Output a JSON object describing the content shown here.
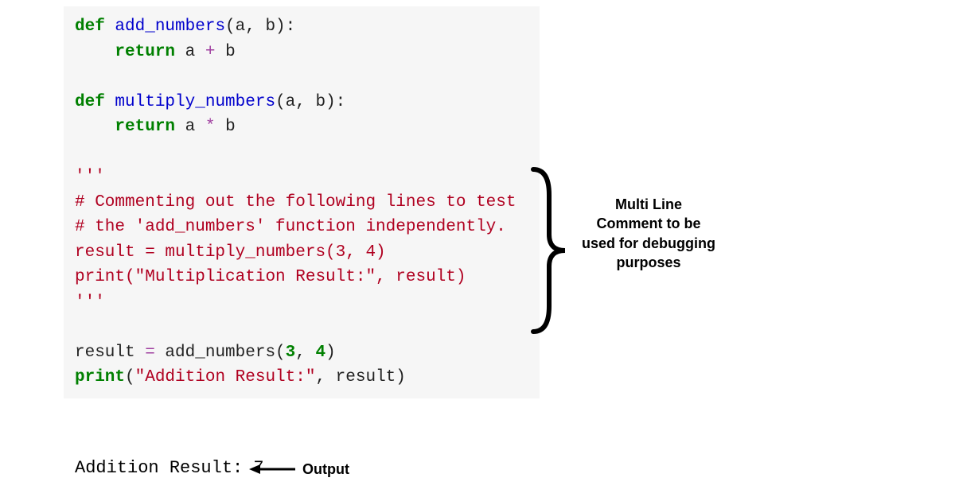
{
  "code": {
    "l1": {
      "def": "def",
      "sp1": " ",
      "name": "add_numbers",
      "sig": "(a, b):"
    },
    "l2": {
      "indent": "    ",
      "ret": "return",
      "sp": " a ",
      "op": "+",
      "b": " b"
    },
    "l3": "",
    "l4": {
      "def": "def",
      "sp1": " ",
      "name": "multiply_numbers",
      "sig": "(a, b):"
    },
    "l5": {
      "indent": "    ",
      "ret": "return",
      "sp": " a ",
      "op": "*",
      "b": " b"
    },
    "l6": "",
    "l7": "'''",
    "l8": "# Commenting out the following lines to test",
    "l9": "# the 'add_numbers' function independently.",
    "l10": "result = multiply_numbers(3, 4)",
    "l11": "print(\"Multiplication Result:\", result)",
    "l12": "'''",
    "l13": "",
    "l14": {
      "a": "result ",
      "eq": "=",
      "b": " add_numbers(",
      "n1": "3",
      "c": ", ",
      "n2": "4",
      "d": ")"
    },
    "l15": {
      "p": "print",
      "a": "(",
      "s": "\"Addition Result:\"",
      "b": ", result)"
    }
  },
  "output": "Addition Result: 7",
  "output_label": "Output",
  "annotation": "Multi Line Comment to be used for debugging purposes"
}
